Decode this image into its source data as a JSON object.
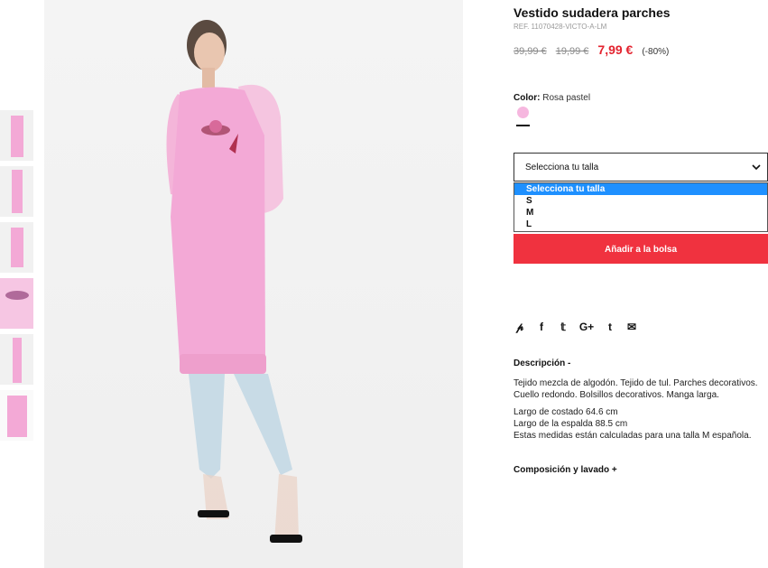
{
  "product": {
    "title": "Vestido sudadera parches",
    "ref": "REF. 11070428-VICTO-A-LM",
    "price_original": "39,99 €",
    "price_previous": "19,99 €",
    "price_current": "7,99 €",
    "discount": "(-80%)"
  },
  "color": {
    "label": "Color:",
    "value": "Rosa pastel",
    "swatch": "#f6b7df"
  },
  "size": {
    "placeholder": "Selecciona tu talla",
    "options": [
      "Selecciona tu talla",
      "S",
      "M",
      "L"
    ],
    "selected_index": 0
  },
  "actions": {
    "add_to_bag": "Añadir a la bolsa"
  },
  "share_icons": [
    "pinterest-icon",
    "facebook-icon",
    "twitter-icon",
    "google-plus-icon",
    "tumblr-icon",
    "email-icon"
  ],
  "description": {
    "title": "Descripción -",
    "line1": "Tejido mezcla de algodón. Tejido de tul. Parches decorativos. Cuello redondo. Bolsillos decorativos. Manga larga.",
    "line2": "Largo de costado 64.6 cm",
    "line3": "Largo de la espalda 88.5 cm",
    "line4": "Estas medidas están calculadas para una talla M española."
  },
  "composition": {
    "title": "Composición y lavado +"
  },
  "colors": {
    "accent": "#f0323f",
    "price_red": "#e3232f",
    "selection_blue": "#1e90ff",
    "dress_pink": "#f3a9d6"
  }
}
